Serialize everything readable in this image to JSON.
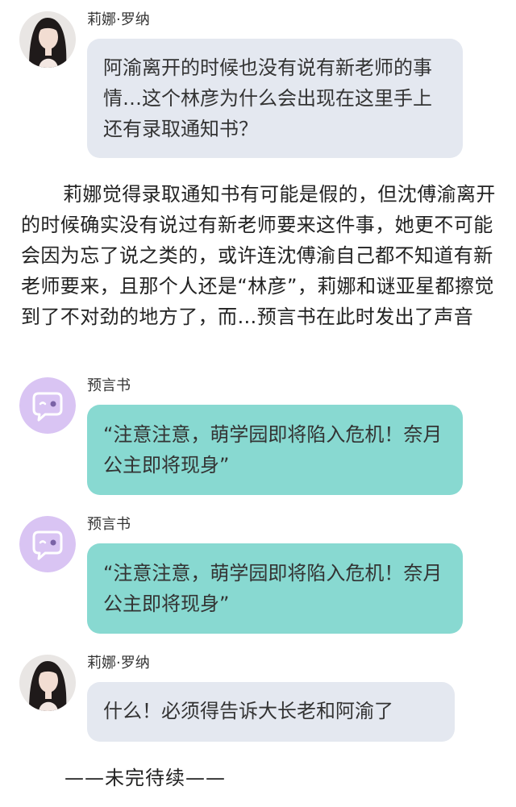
{
  "messages": [
    {
      "sender": "莉娜·罗纳",
      "avatar_icon": "girl-portrait-avatar",
      "text": "阿渝离开的时候也没有说有新老师的事情…这个林彦为什么会出现在这里手上还有录取通知书？"
    },
    {
      "sender": "预言书",
      "avatar_icon": "chat-bubble-face-icon",
      "text": "“注意注意，萌学园即将陷入危机！奈月公主即将现身”"
    },
    {
      "sender": "预言书",
      "avatar_icon": "chat-bubble-face-icon",
      "text": "“注意注意，萌学园即将陷入危机！奈月公主即将现身”"
    },
    {
      "sender": "莉娜·罗纳",
      "avatar_icon": "girl-portrait-avatar",
      "text": "什么！必须得告诉大长老和阿渝了"
    }
  ],
  "narration": "莉娜觉得录取通知书有可能是假的，但沈傅渝离开的时候确实没有说过有新老师要来这件事，她更不可能会因为忘了说之类的，或许连沈傅渝自己都不知道有新老师要来，且那个人还是“林彦”，莉娜和谜亚星都擦觉到了不对劲的地方了，而…预言书在此时发出了声音",
  "ending": "——未完待续——",
  "colors": {
    "gray_bubble": "#e4e8f0",
    "teal_bubble": "#88d9d1",
    "book_avatar_bg": "#d9c4f3",
    "book_avatar_icon": "#ffffff"
  }
}
